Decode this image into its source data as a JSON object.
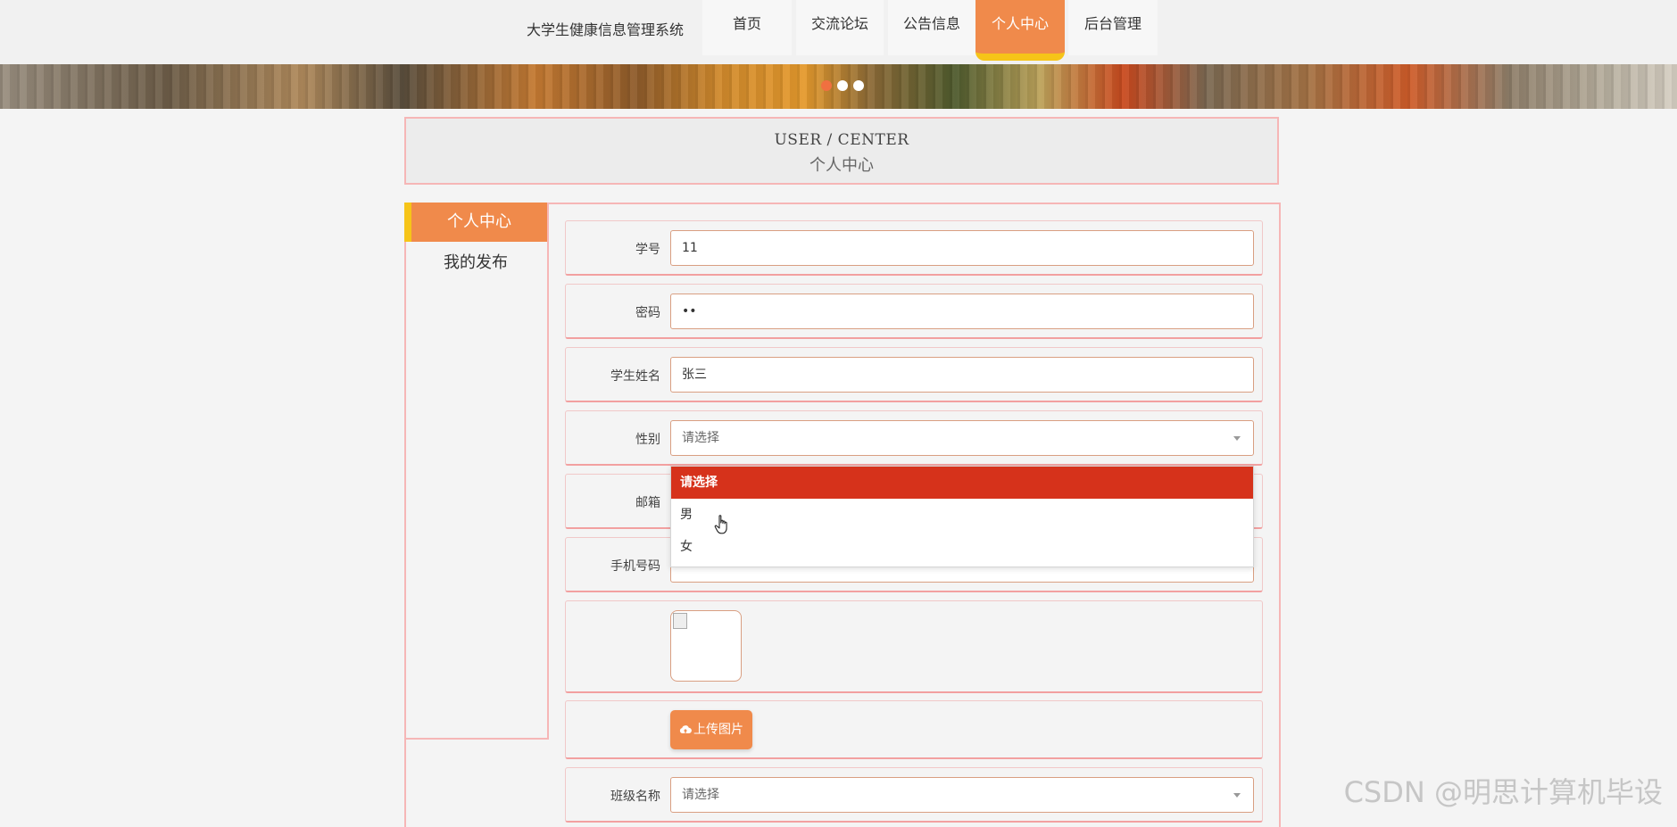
{
  "header": {
    "site_title": "大学生健康信息管理系统",
    "nav": [
      "首页",
      "交流论坛",
      "公告信息",
      "个人中心",
      "后台管理"
    ],
    "active_nav": "个人中心"
  },
  "page_header": {
    "en": "USER / CENTER",
    "cn": "个人中心"
  },
  "sidebar": {
    "items": [
      "个人中心",
      "我的发布"
    ],
    "active": "个人中心"
  },
  "form": {
    "student_id": {
      "label": "学号",
      "value": "11"
    },
    "password": {
      "label": "密码",
      "value": "••"
    },
    "name": {
      "label": "学生姓名",
      "value": "张三"
    },
    "gender": {
      "label": "性别",
      "value": "请选择",
      "options": [
        "请选择",
        "男",
        "女"
      ]
    },
    "email": {
      "label": "邮箱"
    },
    "phone": {
      "label": "手机号码"
    },
    "upload_label": "上传图片",
    "class_name": {
      "label": "班级名称",
      "value": "请选择"
    }
  },
  "watermark": "CSDN @明思计算机毕设",
  "colors": {
    "accent": "#f08a4b",
    "highlight": "#d6321b",
    "border": "#f6b6b6",
    "active_bar": "#f6c418"
  }
}
